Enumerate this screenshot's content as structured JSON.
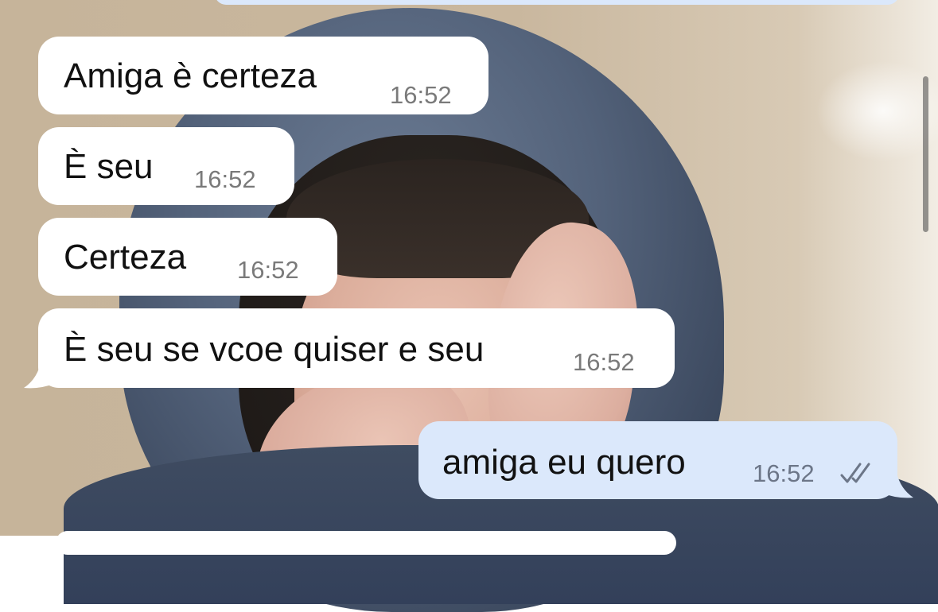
{
  "messages": [
    {
      "direction": "incoming",
      "text": "Amiga è certeza",
      "time": "16:52"
    },
    {
      "direction": "incoming",
      "text": "È seu",
      "time": "16:52"
    },
    {
      "direction": "incoming",
      "text": "Certeza",
      "time": "16:52"
    },
    {
      "direction": "incoming",
      "text": "È seu se vcoe quiser e seu",
      "time": "16:52"
    },
    {
      "direction": "outgoing",
      "text": "amiga eu quero",
      "time": "16:52",
      "status_icon": "double-check-icon"
    }
  ],
  "colors": {
    "incoming_bubble": "#ffffff",
    "outgoing_bubble": "#dbe8fb",
    "text": "#111111",
    "timestamp": "#7a7a7a",
    "read_check": "#6c7688"
  }
}
